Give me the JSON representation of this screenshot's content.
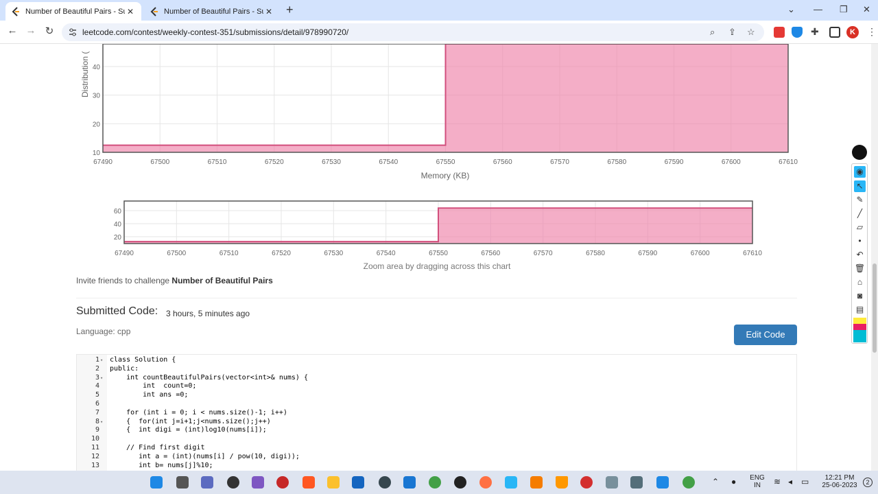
{
  "browser": {
    "tabs": [
      {
        "title": "Number of Beautiful Pairs - Subm",
        "close": "✕"
      },
      {
        "title": "Number of Beautiful Pairs - Subm",
        "close": "✕"
      }
    ],
    "new_tab": "+",
    "url": "leetcode.com/contest/weekly-contest-351/submissions/detail/978990720/",
    "profile_initial": "K"
  },
  "memory_chart": {
    "y_label": "Distribution (",
    "x_label": "Memory (KB)",
    "x_ticks": [
      "67490",
      "67500",
      "67510",
      "67520",
      "67530",
      "67540",
      "67550",
      "67560",
      "67570",
      "67580",
      "67590",
      "67600",
      "67610"
    ],
    "y_ticks": [
      "10",
      "20",
      "30",
      "40"
    ]
  },
  "navigator_chart": {
    "caption": "Zoom area by dragging across this chart",
    "x_ticks": [
      "67490",
      "67500",
      "67510",
      "67520",
      "67530",
      "67540",
      "67550",
      "67560",
      "67570",
      "67580",
      "67590",
      "67600",
      "67610"
    ],
    "y_ticks": [
      "20",
      "40",
      "60"
    ]
  },
  "chart_data": {
    "type": "area",
    "xlabel": "Memory (KB)",
    "ylabel": "Distribution (",
    "x": [
      67490,
      67550,
      67550,
      67610
    ],
    "y": [
      12.5,
      12.5,
      64,
      64
    ],
    "xlim": [
      67490,
      67610
    ],
    "color": "#ee82a9"
  },
  "invite": {
    "prefix": "Invite friends to challenge ",
    "problem": "Number of Beautiful Pairs"
  },
  "submission": {
    "title": "Submitted Code:",
    "time": "3 hours, 5 minutes ago",
    "language": "Language: cpp",
    "edit_label": "Edit Code"
  },
  "code_lines": [
    {
      "n": "1",
      "fold": true,
      "text": "class Solution {"
    },
    {
      "n": "2",
      "fold": false,
      "text": "public:"
    },
    {
      "n": "3",
      "fold": true,
      "text": "    int countBeautifulPairs(vector<int>& nums) {"
    },
    {
      "n": "4",
      "fold": false,
      "text": "        int  count=0;"
    },
    {
      "n": "5",
      "fold": false,
      "text": "        int ans =0;"
    },
    {
      "n": "6",
      "fold": false,
      "text": ""
    },
    {
      "n": "7",
      "fold": false,
      "text": "    for (int i = 0; i < nums.size()-1; i++)"
    },
    {
      "n": "8",
      "fold": true,
      "text": "    {  for(int j=i+1;j<nums.size();j++)"
    },
    {
      "n": "9",
      "fold": false,
      "text": "    {  int digi = (int)log10(nums[i]);"
    },
    {
      "n": "10",
      "fold": false,
      "text": ""
    },
    {
      "n": "11",
      "fold": false,
      "text": "    // Find first digit"
    },
    {
      "n": "12",
      "fold": false,
      "text": "       int a = (int)(nums[i] / pow(10, digi));"
    },
    {
      "n": "13",
      "fold": false,
      "text": "       int b= nums[j]%10;"
    }
  ],
  "taskbar": {
    "lang_top": "ENG",
    "lang_bottom": "IN",
    "time": "12:21 PM",
    "date": "25-06-2023",
    "notif_count": "2"
  },
  "colors": {
    "accent": "#337ab7",
    "chart_fill": "#ee82a9",
    "chart_line": "#d24f7c",
    "chrome": "#d3e3fd"
  }
}
